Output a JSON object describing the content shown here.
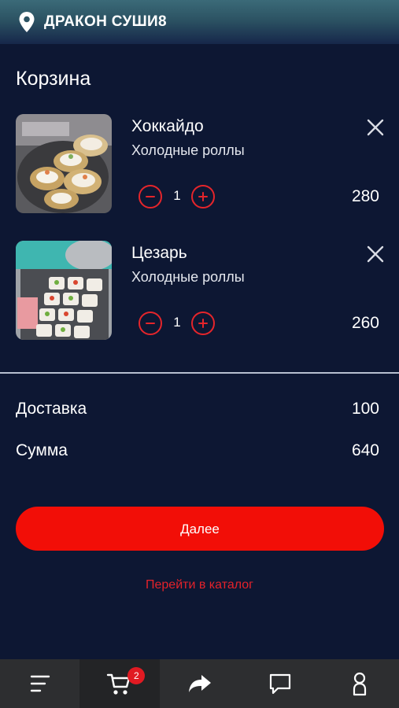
{
  "header": {
    "location_icon": "location-pin-icon",
    "brand": "ДРАКОН СУШИ8"
  },
  "cart": {
    "title": "Корзина",
    "items": [
      {
        "name": "Хоккайдо",
        "category": "Холодные роллы",
        "quantity": "1",
        "price": "280"
      },
      {
        "name": "Цезарь",
        "category": "Холодные роллы",
        "quantity": "1",
        "price": "260"
      }
    ]
  },
  "summary": {
    "delivery_label": "Доставка",
    "delivery_value": "100",
    "total_label": "Сумма",
    "total_value": "640"
  },
  "actions": {
    "next_label": "Далее",
    "catalog_link": "Перейти в каталог"
  },
  "bottom_nav": {
    "items": [
      {
        "icon": "menu-icon"
      },
      {
        "icon": "cart-icon",
        "badge": "2",
        "active": true
      },
      {
        "icon": "share-icon"
      },
      {
        "icon": "chat-icon"
      },
      {
        "icon": "profile-icon"
      }
    ]
  },
  "colors": {
    "background": "#0d1733",
    "accent": "#f20e07",
    "link": "#e4222a",
    "nav_background": "#2d2e30"
  }
}
